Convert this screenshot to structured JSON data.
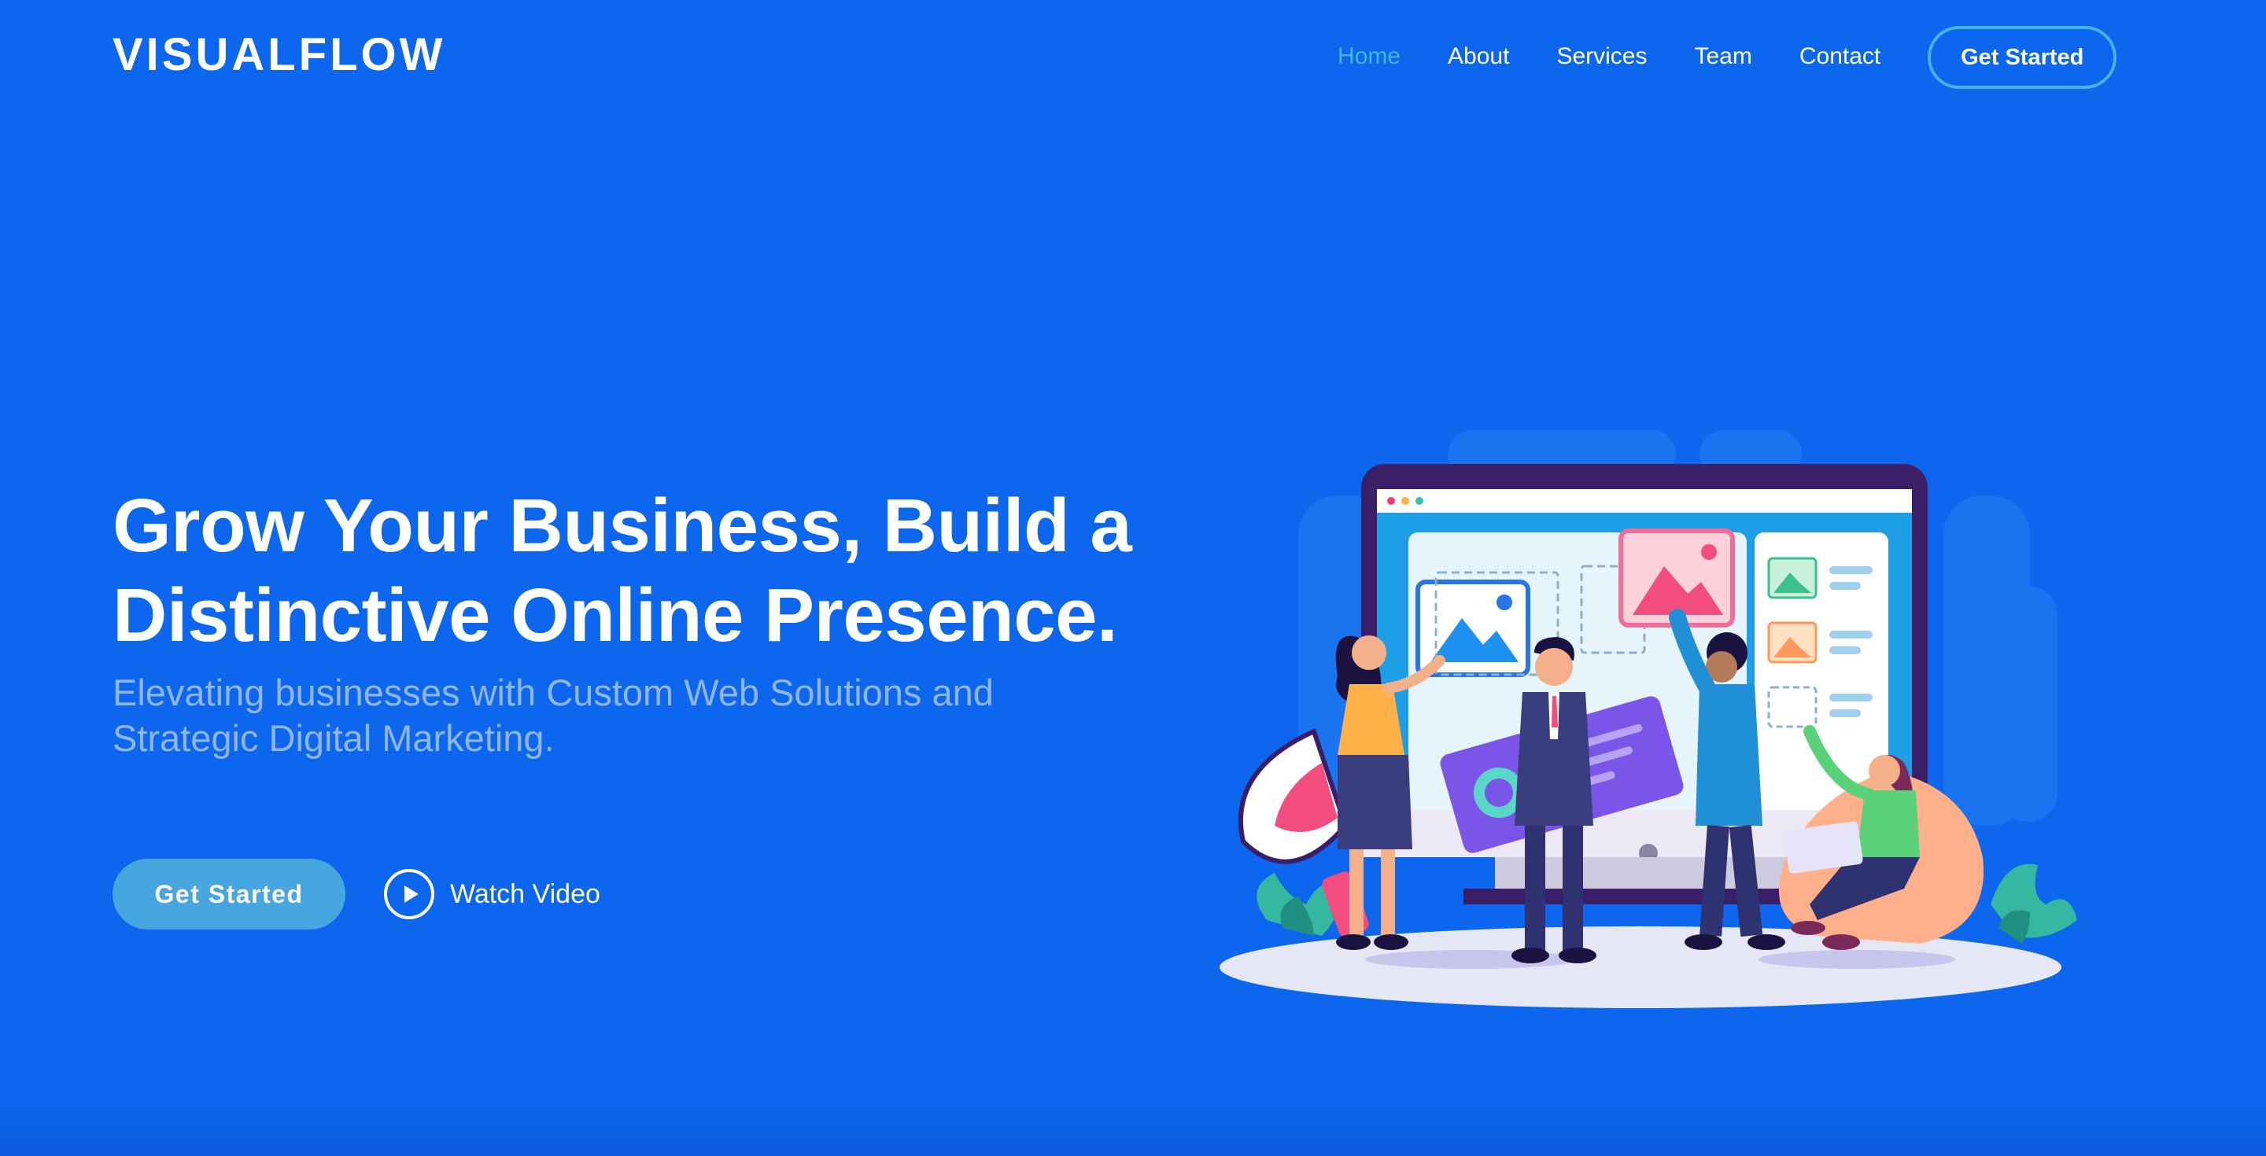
{
  "header": {
    "logo": "VISUALFLOW",
    "nav": [
      {
        "label": "Home",
        "active": true
      },
      {
        "label": "About",
        "active": false
      },
      {
        "label": "Services",
        "active": false
      },
      {
        "label": "Team",
        "active": false
      },
      {
        "label": "Contact",
        "active": false
      }
    ],
    "cta_label": "Get Started"
  },
  "hero": {
    "title": "Grow Your Business, Build a Distinctive Online Presence.",
    "subtitle": "Elevating businesses with Custom Web Solutions and Strategic Digital Marketing.",
    "primary_button": "Get Started",
    "video_button": "Watch Video",
    "video_icon": "play-circle-icon",
    "illustration": "team-building-website-illustration"
  },
  "colors": {
    "background": "#0c66ee",
    "accent": "#47b2e4",
    "button": "#47a6e0",
    "subtitle": "#8fb6ee",
    "text": "#ffffff"
  }
}
